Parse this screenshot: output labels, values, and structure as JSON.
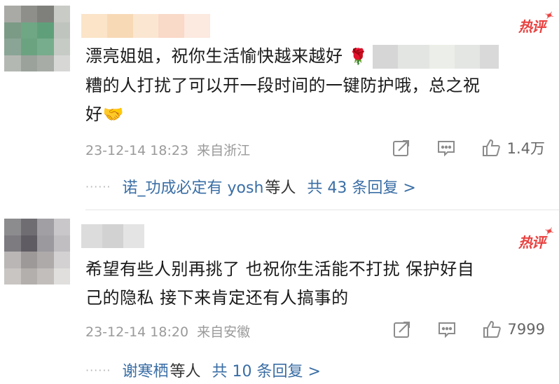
{
  "comments": [
    {
      "badge": "热评",
      "text_line1": "漂亮姐姐，祝你生活愉快越来越好",
      "text_line2": "糟的人打扰了可以开一段时间的一键防护哦，总之祝",
      "text_line3": "好",
      "emoji_rose": "🌹",
      "emoji_handshake": "🤝",
      "timestamp": "23-12-14 18:23",
      "location": "来自浙江",
      "likes": "1.4万",
      "reply_dots": "······",
      "reply_names": "诺_功成必定有 yosh",
      "reply_suffix": "等人",
      "reply_count": "共 43 条回复 >"
    },
    {
      "badge": "热评",
      "text_line1": "希望有些人别再挑了 也祝你生活能不打扰 保护好自",
      "text_line2": "己的隐私 接下来肯定还有人搞事的",
      "timestamp": "23-12-14 18:20",
      "location": "来自安徽",
      "likes": "7999",
      "reply_dots": "······",
      "reply_names": "谢寒栖",
      "reply_suffix": "等人",
      "reply_count": "共 10 条回复 >"
    }
  ],
  "icons": [
    "share-icon",
    "comment-icon",
    "like-icon"
  ],
  "colors": {
    "badge": "#e8413f",
    "link": "#3a6ea5",
    "meta": "#9a9a9a"
  }
}
